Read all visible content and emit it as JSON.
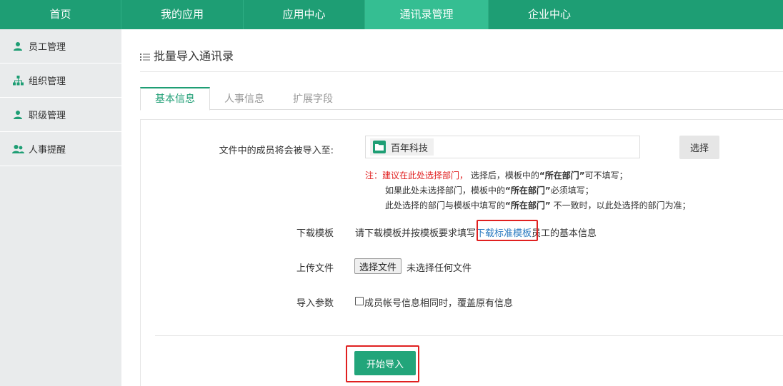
{
  "topnav": {
    "items": [
      {
        "label": "首页"
      },
      {
        "label": "我的应用"
      },
      {
        "label": "应用中心"
      },
      {
        "label": "通讯录管理"
      },
      {
        "label": "企业中心"
      }
    ],
    "active_index": 3
  },
  "sidebar": {
    "items": [
      {
        "label": "员工管理",
        "icon": "user-icon"
      },
      {
        "label": "组织管理",
        "icon": "org-tree-icon"
      },
      {
        "label": "职级管理",
        "icon": "user-icon"
      },
      {
        "label": "人事提醒",
        "icon": "users-icon"
      }
    ]
  },
  "page": {
    "title": "批量导入通讯录"
  },
  "tabs": [
    {
      "label": "基本信息"
    },
    {
      "label": "人事信息"
    },
    {
      "label": "扩展字段"
    }
  ],
  "form": {
    "target_label": "文件中的成员将会被导入至:",
    "selected_org": "百年科技",
    "choose_button": "选择",
    "note": {
      "prefix": "注：建议在此处选择部门，",
      "line1_a": " 选择后，模板中的",
      "line1_b": "“所在部门”",
      "line1_c": "可不填写；",
      "line2_a": "如果此处未选择部门，模板中的",
      "line2_b": "“所在部门”",
      "line2_c": "必须填写；",
      "line3_a": "此处选择的部门与模板中填写的",
      "line3_b": "“所在部门”",
      "line3_c": " 不一致时，以此处选择的部门为准；"
    },
    "template_label": "下载模板",
    "template_text_a": "请下载模板并按模板要求填写",
    "template_link": "下载标准模板",
    "template_text_b": "员工的基本信息",
    "upload_label": "上传文件",
    "upload_button": "选择文件",
    "upload_status": "未选择任何文件",
    "param_label": "导入参数",
    "param_checkbox": "成员帐号信息相同时，覆盖原有信息",
    "param_checked": false,
    "start_button": "开始导入"
  },
  "colors": {
    "brand": "#1e9e74",
    "nav_active": "#35be92",
    "highlight": "#e02020",
    "link": "#2a7ac0"
  }
}
